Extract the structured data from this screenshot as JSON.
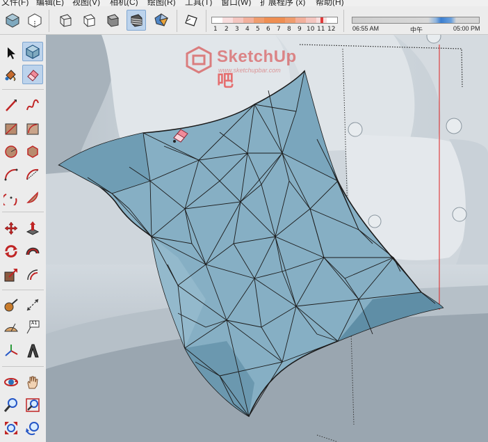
{
  "menu": {
    "items": [
      "文件(F)",
      "编辑(E)",
      "视图(V)",
      "相机(C)",
      "绘图(R)",
      "工具(T)",
      "窗口(W)",
      "扩展程序 (x)",
      "帮助(H)"
    ]
  },
  "shadow_settings": {
    "months": [
      "1",
      "2",
      "3",
      "4",
      "5",
      "6",
      "7",
      "8",
      "9",
      "10",
      "11",
      "12"
    ],
    "time_start": "06:55 AM",
    "time_middle": "中午",
    "time_end": "05:00 PM"
  },
  "toolbar": {
    "buttons": [
      "xray-style-icon",
      "back-edges-style-icon",
      "wireframe-style-icon",
      "hidden-line-style-icon",
      "shaded-style-icon",
      "shaded-textures-style-icon",
      "monochrome-style-icon",
      "section-plane-icon"
    ],
    "active_button": "shaded-textures-style-icon"
  },
  "tools": {
    "active_tool": "eraser-tool",
    "items": [
      "select-tool",
      "make-component-tool",
      "paint-bucket-tool",
      "eraser-tool",
      "line-tool",
      "freehand-tool",
      "rectangle-tool",
      "rotated-rectangle-tool",
      "circle-tool",
      "polygon-tool",
      "arc-tool",
      "two-point-arc-tool",
      "three-point-arc-tool",
      "pie-tool",
      "move-tool",
      "push-pull-tool",
      "rotate-tool",
      "follow-me-tool",
      "scale-tool",
      "offset-tool",
      "tape-measure-tool",
      "dimension-tool",
      "protractor-tool",
      "text-tool",
      "axes-tool",
      "3d-text-tool",
      "orbit-tool",
      "pan-tool",
      "zoom-tool",
      "zoom-window-tool",
      "zoom-extents-tool",
      "previous-view-tool"
    ],
    "text_tool_label": "A1"
  },
  "watermark": {
    "title": "SketchUp",
    "title_suffix": "吧",
    "url": "www.sketchupbar.com"
  },
  "colors": {
    "pillow": "#7fa9bf",
    "pillow_dark": "#5f8ba3",
    "sofa": "#c3ccd4",
    "selection_blue": "#bcd3ec",
    "axis_red": "#e02020",
    "eraser_pink": "#f08b9a"
  }
}
